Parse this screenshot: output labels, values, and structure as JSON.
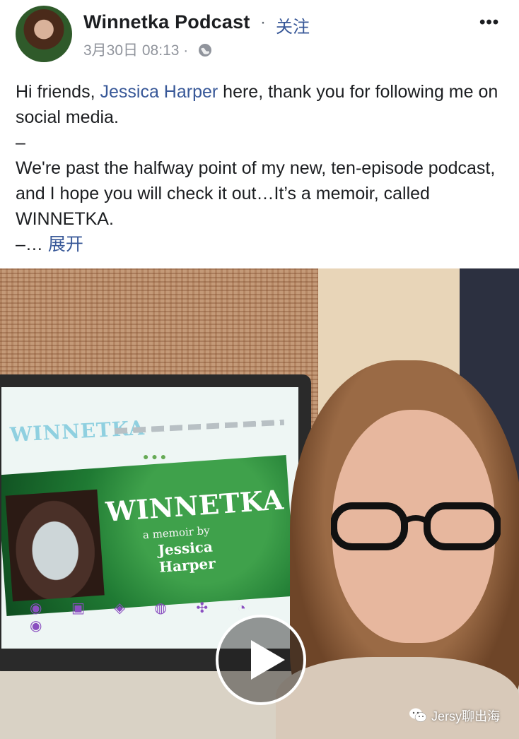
{
  "post": {
    "page_name": "Winnetka Podcast",
    "separator": "·",
    "follow_label": "关注",
    "timestamp": "3月30日 08:13",
    "meta_separator": "·",
    "privacy_icon": "globe-icon",
    "more_label": "•••"
  },
  "body": {
    "line1_prefix": "Hi friends, ",
    "mention": "Jessica Harper",
    "line1_suffix": " here, thank you for following me on social media.",
    "dash1": "–",
    "paragraph2": "We're past the halfway point of my new, ten-episode podcast, and I hope you will check it out…It’s a memoir, called WINNETKA.",
    "dash2_prefix": "–… ",
    "expand_label": "展开"
  },
  "media": {
    "screen_logo": "WINNETKA",
    "banner_title": "WINNETKA",
    "banner_sub": "a memoir by",
    "banner_author_first": "Jessica",
    "banner_author_last": "Harper",
    "play_icon": "play-icon"
  },
  "watermark": {
    "icon": "wechat-icon",
    "text": "Jersy聊出海"
  },
  "colors": {
    "link": "#385898",
    "text": "#1c1e21",
    "meta": "#90949c"
  }
}
